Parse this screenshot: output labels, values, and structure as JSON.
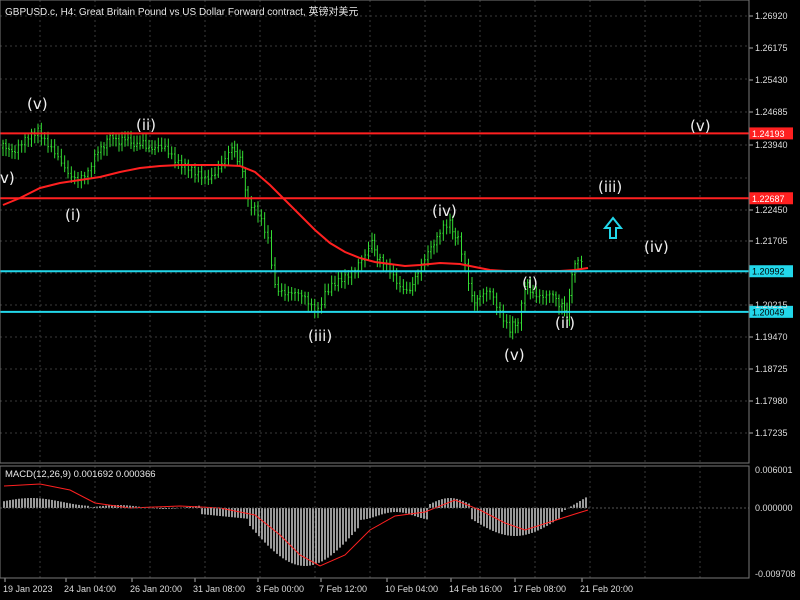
{
  "header": {
    "title": "GBPUSD.c, H4:  Great Britain Pound vs US Dollar Forward contract, 英镑对美元"
  },
  "macd": {
    "label": "MACD(12,26,9) 0.001692 0.000366",
    "axis": [
      "0.006001",
      "0.000000",
      "-0.009708"
    ]
  },
  "price_axis": [
    "1.26920",
    "1.26175",
    "1.25430",
    "1.24685",
    "1.23940",
    "1.22450",
    "1.21705",
    "1.20215",
    "1.19470",
    "1.18725",
    "1.17980",
    "1.17235"
  ],
  "time_axis": [
    "19 Jan 2023",
    "24 Jan 04:00",
    "26 Jan 20:00",
    "31 Jan 08:00",
    "3 Feb 00:00",
    "7 Feb 12:00",
    "10 Feb 04:00",
    "14 Feb 16:00",
    "17 Feb 08:00",
    "21 Feb 20:00"
  ],
  "levels": [
    {
      "price": 1.24193,
      "label": "1.24193",
      "color": "#ff2020"
    },
    {
      "price": 1.22687,
      "label": "1.22687",
      "color": "#ff2020"
    },
    {
      "price": 1.20992,
      "label": "1.20992",
      "color": "#22d7ea"
    },
    {
      "price": 1.20049,
      "label": "1.20049",
      "color": "#22d7ea"
    }
  ],
  "wave_labels": [
    {
      "text": "v)"
    },
    {
      "text": "(v)"
    },
    {
      "text": "(i)"
    },
    {
      "text": "(ii)"
    },
    {
      "text": "(iii)"
    },
    {
      "text": "(iv)"
    },
    {
      "text": "(v)"
    },
    {
      "text": "(i)"
    },
    {
      "text": "(ii)"
    },
    {
      "text": "(iii)"
    },
    {
      "text": "(iv)"
    },
    {
      "text": "(v)"
    }
  ],
  "colors": {
    "candle": "#33dd33",
    "ma": "#ff2020",
    "grid": "#3a3a3a",
    "macd_hist": "#c0c0c0",
    "macd_signal": "#ff2020",
    "arrow": "#22d7ea"
  },
  "icons": [
    "up-arrow-icon"
  ]
}
